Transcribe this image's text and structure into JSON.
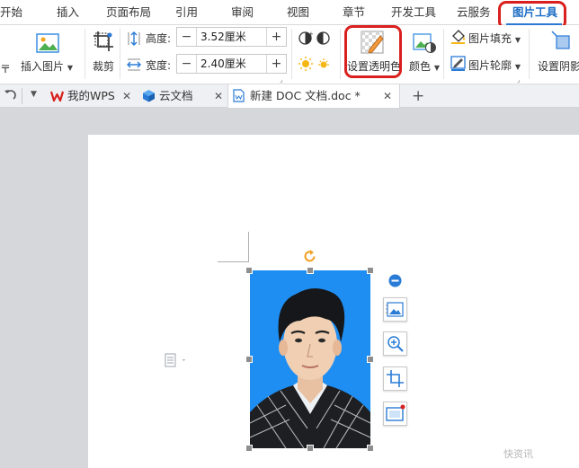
{
  "ribbon_tabs": [
    {
      "label": "开始"
    },
    {
      "label": "插入"
    },
    {
      "label": "页面布局"
    },
    {
      "label": "引用"
    },
    {
      "label": "审阅"
    },
    {
      "label": "视图"
    },
    {
      "label": "章节"
    },
    {
      "label": "开发工具"
    },
    {
      "label": "云服务"
    },
    {
      "label": "图片工具"
    }
  ],
  "active_tab": "图片工具",
  "toolbar": {
    "insert_image_label": "插入图片",
    "crop_label": "裁剪",
    "height_label": "高度:",
    "height_value": "3.52厘米",
    "width_label": "宽度:",
    "width_value": "2.40厘米",
    "set_transparent_label": "设置透明色",
    "color_label": "颜色",
    "fill_label": "图片填充",
    "outline_label": "图片轮廓",
    "shadow_label": "设置阴影"
  },
  "doc_tabs": [
    {
      "label": "我的WPS"
    },
    {
      "label": "云文档"
    },
    {
      "label": "新建 DOC 文档.doc *"
    }
  ],
  "watermark": "快资讯",
  "colors": {
    "accent": "#2b79d0",
    "highlight": "#d9201e",
    "photo_background": "#1e8ef2",
    "workspace": "#d5d7db"
  }
}
